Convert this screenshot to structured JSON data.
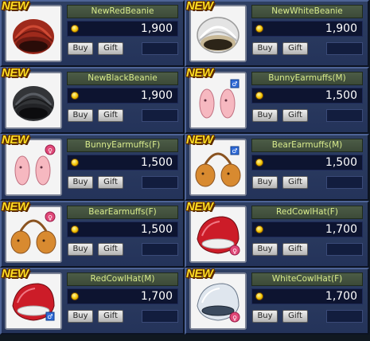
{
  "shop": {
    "badge_text": "NEW",
    "buy_label": "Buy",
    "gift_label": "Gift",
    "currency_icon": "coin-icon",
    "items": [
      {
        "name": "NewRedBeanie",
        "price": "1,900",
        "icon": "red-beanie-icon"
      },
      {
        "name": "NewWhiteBeanie",
        "price": "1,900",
        "icon": "white-beanie-icon"
      },
      {
        "name": "NewBlackBeanie",
        "price": "1,900",
        "icon": "black-beanie-icon"
      },
      {
        "name": "BunnyEarmuffs(M)",
        "price": "1,500",
        "icon": "bunny-earmuffs-icon"
      },
      {
        "name": "BunnyEarmuffs(F)",
        "price": "1,500",
        "icon": "bunny-earmuffs-icon"
      },
      {
        "name": "BearEarmuffs(M)",
        "price": "1,500",
        "icon": "bear-earmuffs-icon"
      },
      {
        "name": "BearEarmuffs(F)",
        "price": "1,500",
        "icon": "bear-earmuffs-icon"
      },
      {
        "name": "RedCowlHat(F)",
        "price": "1,700",
        "icon": "red-cowl-hat-icon"
      },
      {
        "name": "RedCowlHat(M)",
        "price": "1,700",
        "icon": "red-cowl-hat-icon"
      },
      {
        "name": "WhiteCowlHat(F)",
        "price": "1,700",
        "icon": "white-cowl-hat-icon"
      }
    ]
  }
}
